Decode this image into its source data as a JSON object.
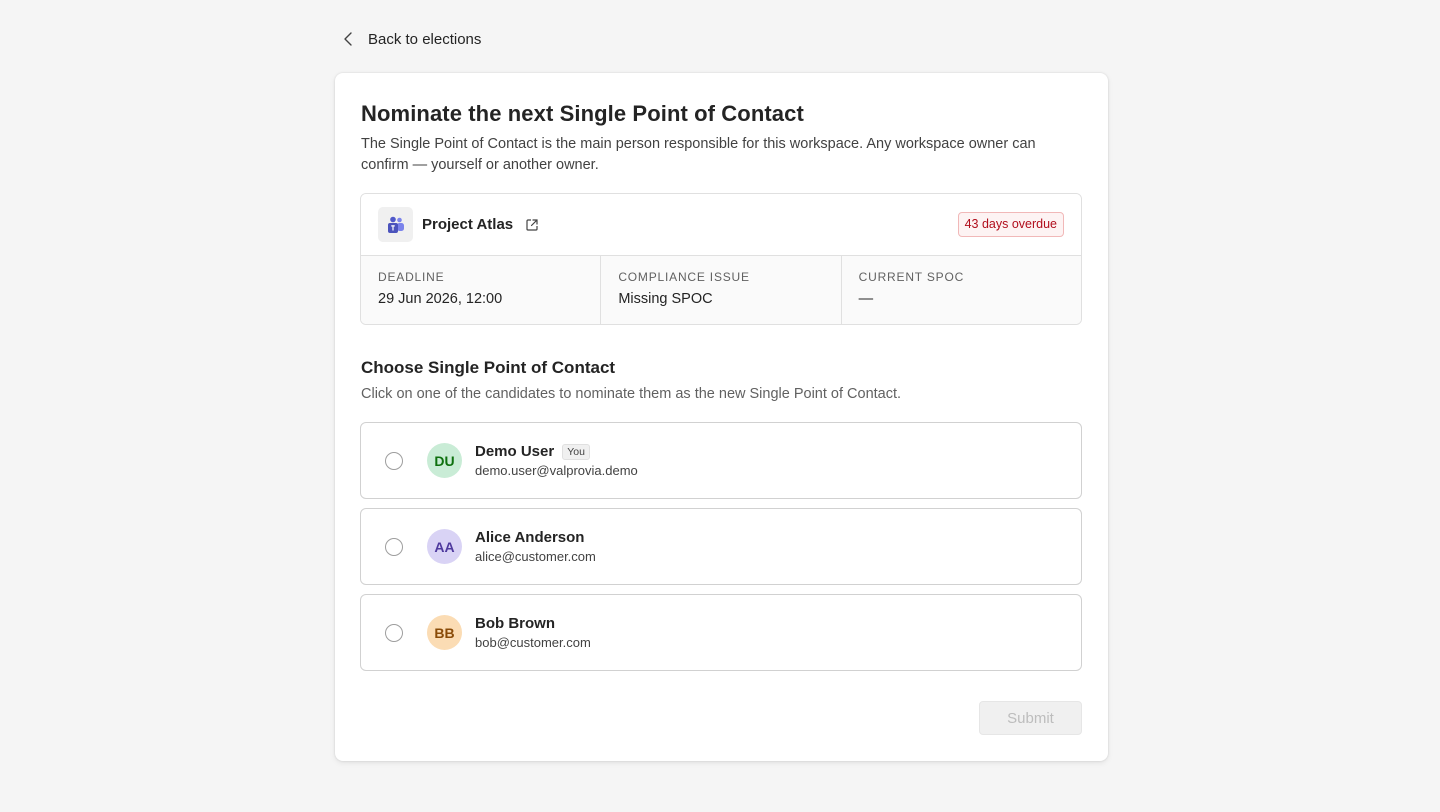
{
  "nav": {
    "back_label": "Back to elections"
  },
  "page": {
    "title": "Nominate the next Single Point of Contact",
    "description": "The Single Point of Contact is the main person responsible for this workspace. Any workspace owner can confirm — yourself or another owner."
  },
  "workspace": {
    "name": "Project Atlas",
    "overdue_label": "43 days overdue",
    "meta": [
      {
        "label": "DEADLINE",
        "value": "29 Jun 2026, 12:00"
      },
      {
        "label": "COMPLIANCE ISSUE",
        "value": "Missing SPOC"
      },
      {
        "label": "CURRENT SPOC",
        "value": "—"
      }
    ]
  },
  "section": {
    "title": "Choose Single Point of Contact",
    "description": "Click on one of the candidates to nominate them as the new Single Point of Contact."
  },
  "candidates": [
    {
      "initials": "DU",
      "name": "Demo User",
      "badge": "You",
      "email": "demo.user@valprovia.demo",
      "avatar_bg": "#c9ecd6",
      "avatar_fg": "#0e700e"
    },
    {
      "initials": "AA",
      "name": "Alice Anderson",
      "badge": "",
      "email": "alice@customer.com",
      "avatar_bg": "#d9d3f5",
      "avatar_fg": "#4f3a9e"
    },
    {
      "initials": "BB",
      "name": "Bob Brown",
      "badge": "",
      "email": "bob@customer.com",
      "avatar_bg": "#fbdcb4",
      "avatar_fg": "#8a4b08"
    }
  ],
  "actions": {
    "submit_label": "Submit"
  },
  "icons": {
    "back": "chevron-left-icon",
    "workspace": "teams-icon",
    "external": "open-external-icon"
  }
}
